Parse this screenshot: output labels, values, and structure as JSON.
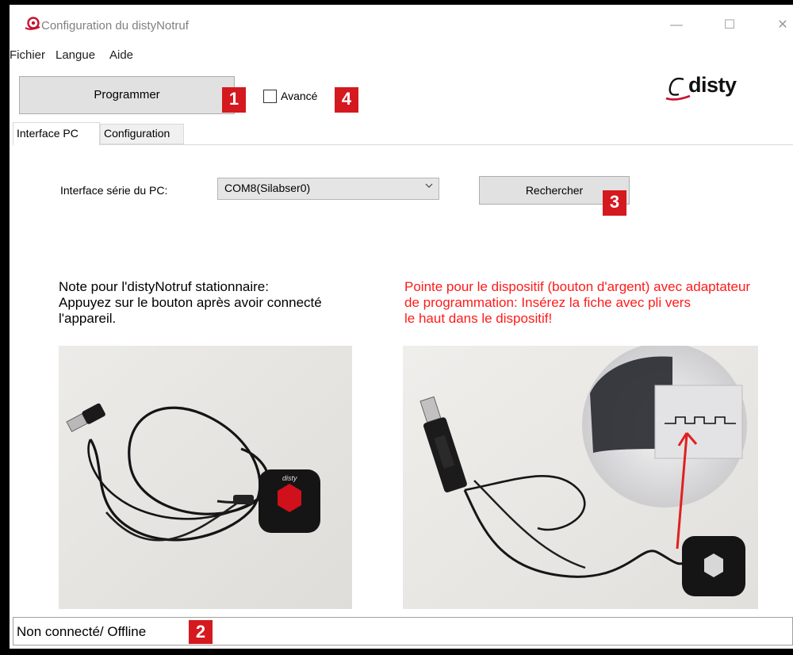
{
  "window": {
    "title": "Configuration du distyNotruf",
    "controls": {
      "minimize": "—",
      "maximize": "☐",
      "close": "✕"
    }
  },
  "menu": {
    "items": [
      {
        "label": "Fichier"
      },
      {
        "label": "Langue"
      },
      {
        "label": "Aide"
      }
    ]
  },
  "toolbar": {
    "programmer_label": "Programmer",
    "advanced_label": "Avancé",
    "advanced_checked": false
  },
  "logo": {
    "text": "disty"
  },
  "badges": {
    "one": "1",
    "two": "2",
    "three": "3",
    "four": "4"
  },
  "tabs": [
    {
      "label": "Interface PC",
      "active": true
    },
    {
      "label": "Configuration",
      "active": false
    }
  ],
  "interface": {
    "label": "Interface série du PC:",
    "selected_port": "COM8(Silabser0)",
    "search_label": "Rechercher"
  },
  "notes": {
    "left": [
      "Note pour l'distyNotruf stationnaire:",
      "Appuyez sur le bouton après avoir connecté",
      "l'appareil."
    ],
    "right": [
      "Pointe pour le dispositif (bouton d'argent) avec adaptateur",
      "de programmation: Insérez la fiche avec pli vers",
      "le haut dans le dispositif!"
    ]
  },
  "status": {
    "text": "Non connecté/ Offline"
  },
  "colors": {
    "badge": "#d4191f",
    "warning_text": "#ff1a1a",
    "button_bg": "#e1e1e1",
    "logo_accent": "#c8102e"
  }
}
